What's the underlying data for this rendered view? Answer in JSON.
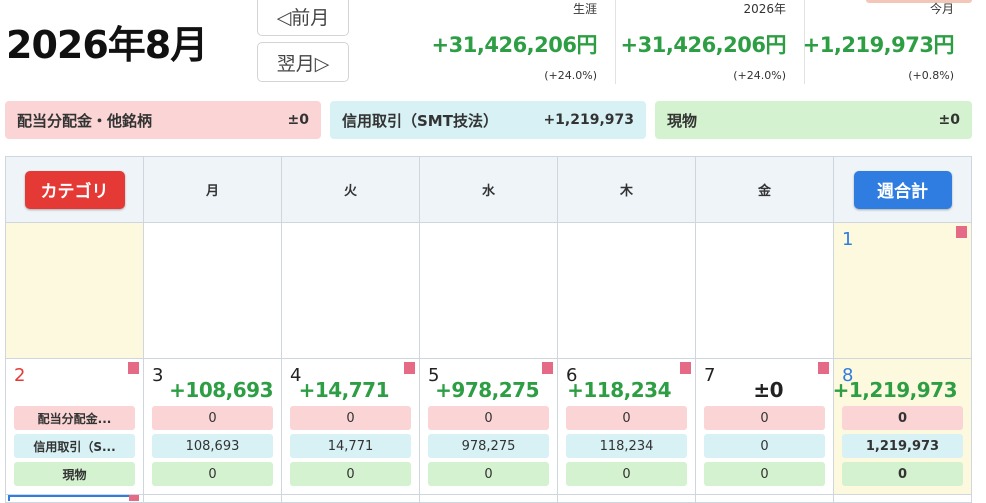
{
  "page_title": "2026年8月",
  "nav": {
    "prev_label": "◁前月",
    "next_label": "翌月▷"
  },
  "stats": [
    {
      "label": "生涯",
      "value": "+31,426,206円",
      "pct": "(+24.0%)"
    },
    {
      "label": "2026年",
      "value": "+31,426,206円",
      "pct": "(+24.0%)"
    },
    {
      "label": "今月",
      "value": "+1,219,973円",
      "pct": "(+0.8%)"
    }
  ],
  "categories": [
    {
      "label": "配当分配金・他銘柄",
      "value": "±0",
      "color": "#fbd5d5"
    },
    {
      "label": "信用取引（SMT技法）",
      "value": "+1,219,973",
      "color": "#d7f1f5"
    },
    {
      "label": "現物",
      "value": "±0",
      "color": "#d4f2cf"
    }
  ],
  "header": {
    "category_button": "カテゴリ",
    "weekdays": [
      "月",
      "火",
      "水",
      "木",
      "金"
    ],
    "week_total_button": "週合計"
  },
  "week1": {
    "sat_day": "1"
  },
  "week2": {
    "category_labels": {
      "day": "2",
      "row1": "配当分配金...",
      "row2": "信用取引（S...",
      "row3": "現物"
    },
    "days": [
      {
        "day": "3",
        "total": "+108,693",
        "r1": "0",
        "r2": "108,693",
        "r3": "0"
      },
      {
        "day": "4",
        "total": "+14,771",
        "r1": "0",
        "r2": "14,771",
        "r3": "0"
      },
      {
        "day": "5",
        "total": "+978,275",
        "r1": "0",
        "r2": "978,275",
        "r3": "0"
      },
      {
        "day": "6",
        "total": "+118,234",
        "r1": "0",
        "r2": "118,234",
        "r3": "0"
      },
      {
        "day": "7",
        "total": "±0",
        "r1": "0",
        "r2": "0",
        "r3": "0"
      }
    ],
    "week_total": {
      "day": "8",
      "total": "+1,219,973",
      "r1": "0",
      "r2": "1,219,973",
      "r3": "0"
    }
  },
  "colors": {
    "positive": "#2e9e45",
    "sunday": "#e53935",
    "saturday": "#2f7de1",
    "weekend_bg": "#fdf9df",
    "flag": "#e46a86"
  }
}
